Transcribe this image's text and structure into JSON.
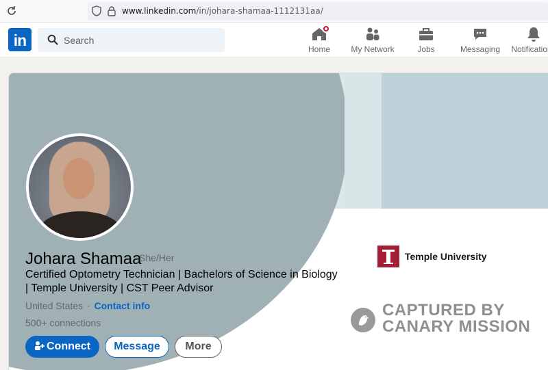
{
  "browser": {
    "url_host": "www.linkedin.com",
    "url_path": "/in/johara-shamaa-1112131aa/"
  },
  "nav": {
    "logo": "in",
    "search_placeholder": "Search",
    "items": [
      {
        "label": "Home",
        "icon": "home-icon",
        "badge": true
      },
      {
        "label": "My Network",
        "icon": "network-icon",
        "badge": false
      },
      {
        "label": "Jobs",
        "icon": "briefcase-icon",
        "badge": false
      },
      {
        "label": "Messaging",
        "icon": "chat-icon",
        "badge": false
      },
      {
        "label": "Notifications",
        "icon": "bell-icon",
        "badge": false
      }
    ]
  },
  "profile": {
    "name": "Johara Shamaa",
    "pronouns": "She/Her",
    "headline": "Certified Optometry Technician | Bachelors of Science in Biology | Temple University | CST Peer Advisor",
    "location": "United States",
    "location_separator": "·",
    "contact_info": "Contact info",
    "connections": "500+ connections",
    "education": "Temple University",
    "buttons": {
      "connect": "Connect",
      "message": "Message",
      "more": "More"
    }
  },
  "watermark": {
    "line1": "CAPTURED BY",
    "line2": "CANARY MISSION"
  },
  "colors": {
    "linkedin_blue": "#0a66c2",
    "temple_cherry": "#a41e35",
    "notification_red": "#cb112d"
  }
}
